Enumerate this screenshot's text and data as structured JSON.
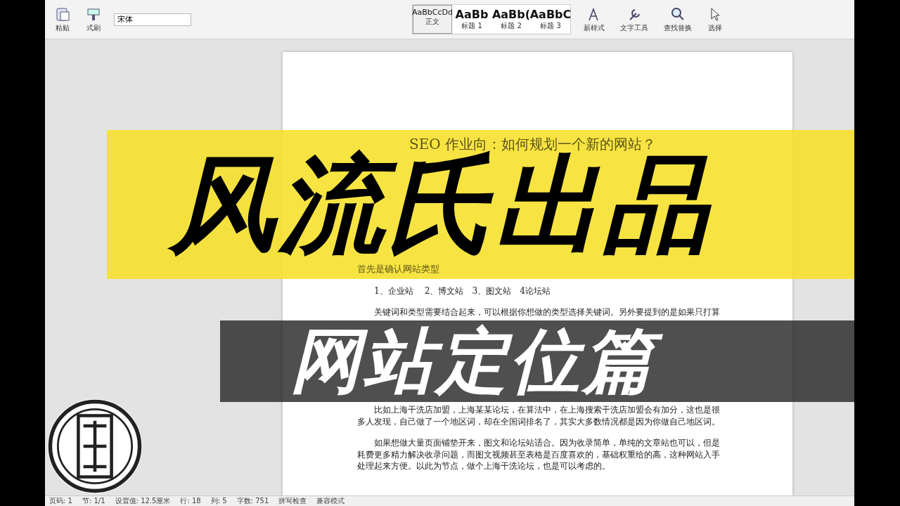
{
  "toolbar": {
    "paste": "粘贴",
    "format_painter": "式刷",
    "font": "宋体",
    "styles": [
      {
        "preview": "AaBbCcDd",
        "label": "正文",
        "selected": true
      },
      {
        "preview": "AaBb",
        "label": "标题 1",
        "selected": false
      },
      {
        "preview": "AaBb(",
        "label": "标题 2",
        "selected": false
      },
      {
        "preview": "AaBbC",
        "label": "标题 3",
        "selected": false
      }
    ],
    "tools": [
      "新样式",
      "文字工具",
      "查找替换",
      "选择"
    ]
  },
  "document": {
    "title": "SEO 作业向：如何规划一个新的网站？",
    "heading": "首先是确认网站类型",
    "list": "1、企业站　 2、博文站　3、图文站　4论坛站",
    "paragraphs_top": [
      "关键词和类型需要结合起来，可以根据你想做的类型选择关键词。另外要提到的是如果只打算"
    ],
    "paragraphs_bottom": [
      "比如上海干洗店加盟，上海某某论坛，在算法中，在上海搜索干洗店加盟会有加分，这也是很多人发现，自己做了一个地区词，却在全国词排名了，其实大多数情况都是因为你做自己地区词。",
      "如果想做大量页面铺垫开来，图文和论坛站适合。因为收录简单，单纯的文章站也可以，但是耗费更多精力解决收录问题，而图文视频甚至表格是百度喜欢的，基础权重给的高，这种网站入手处理起来方便。以此为节点，做个上海干洗论坛，也是可以考虑的。"
    ]
  },
  "banners": [
    {
      "text": "风流氏出品",
      "kind": "yellow"
    },
    {
      "text": "网站定位篇",
      "kind": "dark"
    }
  ],
  "status_bar": [
    "页码: 1",
    "节: 1/1",
    "设置值: 12.5厘米",
    "行: 18",
    "列: 5",
    "字数: 751",
    "拼写检查",
    "兼容模式"
  ]
}
